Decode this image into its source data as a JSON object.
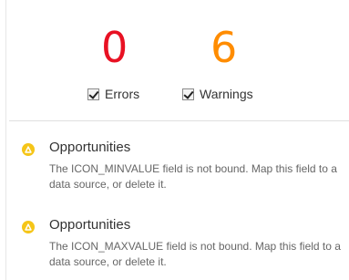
{
  "summary": {
    "errors_count": "0",
    "warnings_count": "6",
    "errors_label": "Errors",
    "warnings_label": "Warnings",
    "errors_checked": true,
    "warnings_checked": true,
    "errors_color": "#e81123",
    "warnings_color": "#ff8c00"
  },
  "issues": [
    {
      "icon": "warning-icon",
      "title": "Opportunities",
      "description": "The ICON_MINVALUE field is not bound. Map this field to a data source, or delete it."
    },
    {
      "icon": "warning-icon",
      "title": "Opportunities",
      "description": "The ICON_MAXVALUE field is not bound. Map this field to a data source, or delete it."
    }
  ]
}
